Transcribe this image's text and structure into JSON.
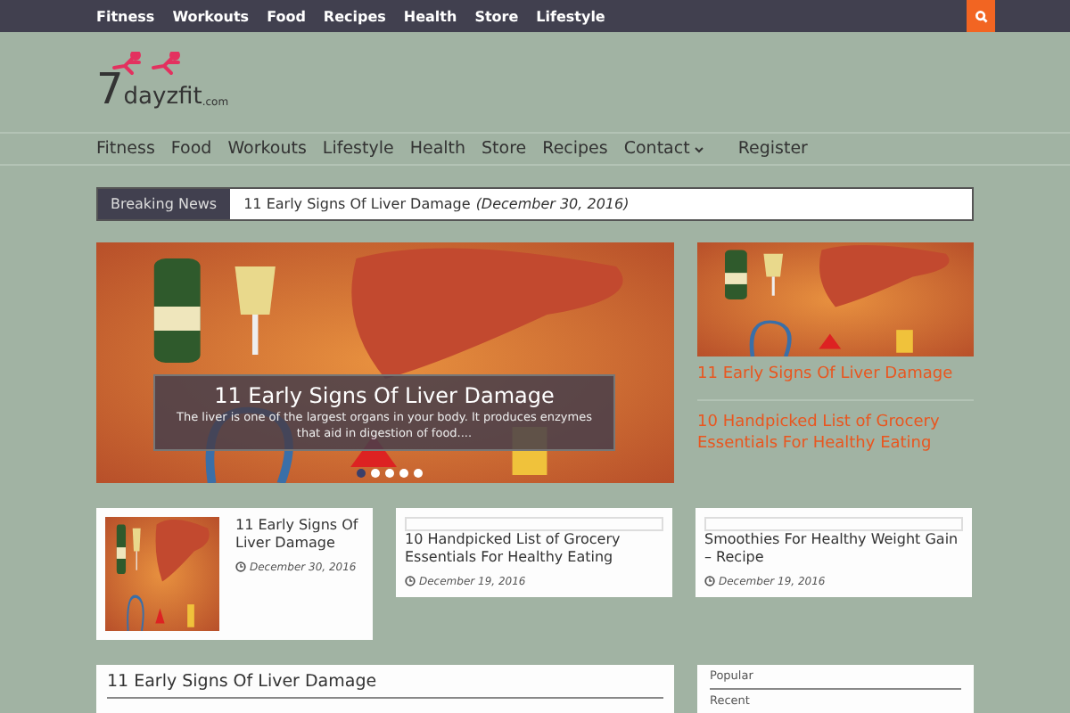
{
  "top_menu": [
    "Fitness",
    "Workouts",
    "Food",
    "Recipes",
    "Health",
    "Store",
    "Lifestyle"
  ],
  "logo": {
    "number": "7",
    "name": "dayzfit",
    "suffix": ".com"
  },
  "main_menu": [
    {
      "label": "Fitness",
      "has_submenu": false
    },
    {
      "label": "Food",
      "has_submenu": false
    },
    {
      "label": "Workouts",
      "has_submenu": false
    },
    {
      "label": "Lifestyle",
      "has_submenu": false
    },
    {
      "label": "Health",
      "has_submenu": false
    },
    {
      "label": "Store",
      "has_submenu": false
    },
    {
      "label": "Recipes",
      "has_submenu": false
    },
    {
      "label": "Contact",
      "has_submenu": true
    },
    {
      "label": "Register",
      "has_submenu": false
    }
  ],
  "breaking_news": {
    "label": "Breaking News",
    "headline": "11 Early Signs Of Liver Damage",
    "date": "(December 30, 2016)"
  },
  "slider": {
    "title": "11 Early Signs Of Liver Damage",
    "excerpt": "The liver is one of the largest organs in your body. It produces enzymes that aid in digestion of food....",
    "dots": [
      {
        "selected": true
      },
      {
        "selected": false
      },
      {
        "selected": false
      },
      {
        "selected": false
      },
      {
        "selected": false
      }
    ]
  },
  "side_posts": [
    "11 Early Signs Of Liver Damage",
    "10 Handpicked List of Grocery Essentials For Healthy Eating"
  ],
  "cards": [
    {
      "kind": "thumbnail",
      "title": "11 Early Signs Of Liver Damage",
      "date": "December 30, 2016"
    },
    {
      "kind": "frame",
      "title": "10 Handpicked List of Grocery Essentials For Healthy Eating",
      "date": "December 19, 2016"
    },
    {
      "kind": "frame",
      "title": "Smoothies For Healthy Weight Gain – Recipe",
      "date": "December 19, 2016"
    }
  ],
  "main_panel": {
    "title": "11 Early Signs Of Liver Damage"
  },
  "sidebar_tabs": [
    {
      "label": "Popular"
    },
    {
      "label": "Recent"
    }
  ]
}
